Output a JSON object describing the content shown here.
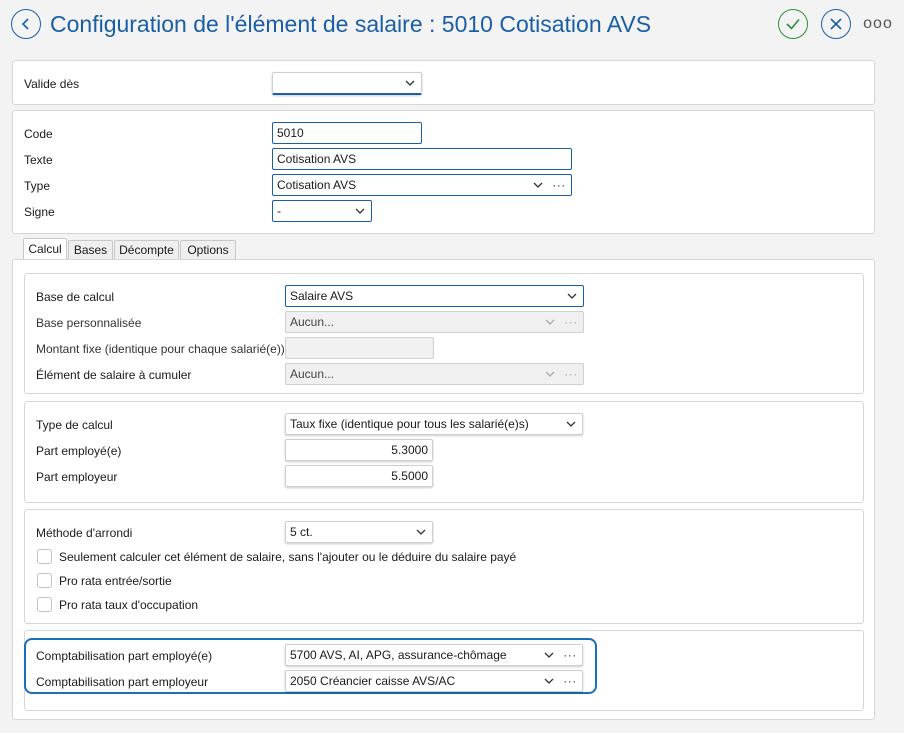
{
  "header": {
    "title": "Configuration de l'élément de salaire : 5010 Cotisation AVS",
    "more_label": "ooo"
  },
  "validity": {
    "label": "Valide dès",
    "value": ""
  },
  "general": {
    "code_label": "Code",
    "code_value": "5010",
    "text_label": "Texte",
    "text_value": "Cotisation AVS",
    "type_label": "Type",
    "type_value": "Cotisation AVS",
    "sign_label": "Signe",
    "sign_value": "-"
  },
  "tabs": [
    {
      "label": "Calcul",
      "active": true
    },
    {
      "label": "Bases",
      "active": false
    },
    {
      "label": "Décompte",
      "active": false
    },
    {
      "label": "Options",
      "active": false
    }
  ],
  "calc_base": {
    "base_label": "Base de calcul",
    "base_value": "Salaire AVS",
    "custom_base_label": "Base personnalisée",
    "custom_base_value": "Aucun...",
    "fixed_amount_label": "Montant fixe (identique pour chaque salarié(e))",
    "fixed_amount_value": "",
    "cumulate_label": "Élément de salaire à cumuler",
    "cumulate_value": "Aucun..."
  },
  "calc_type": {
    "type_label": "Type de calcul",
    "type_value": "Taux fixe (identique pour tous les salarié(e)s)",
    "employee_label": "Part employé(e)",
    "employee_value": "5.3000",
    "employer_label": "Part employeur",
    "employer_value": "5.5000"
  },
  "rounding": {
    "method_label": "Méthode d'arrondi",
    "method_value": "5 ct.",
    "check1_label": "Seulement calculer cet élément de salaire, sans l'ajouter ou le déduire du salaire payé",
    "check1_checked": false,
    "check2_label": "Pro rata entrée/sortie",
    "check2_checked": false,
    "check3_label": "Pro rata taux d'occupation",
    "check3_checked": false
  },
  "accounting": {
    "employee_label": "Comptabilisation part employé(e)",
    "employee_value": "5700 AVS, AI, APG, assurance-chômage",
    "employer_label": "Comptabilisation part employeur",
    "employer_value": "2050 Créancier caisse AVS/AC"
  },
  "colors": {
    "accent": "#1a5fa6",
    "ok": "#2e8b3d",
    "background": "#f3f3f3"
  }
}
